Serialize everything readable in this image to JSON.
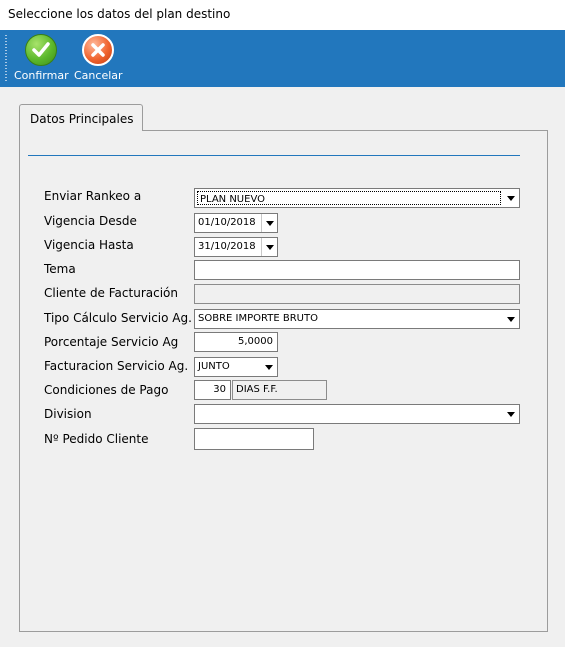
{
  "window": {
    "title": "Seleccione los datos del plan destino"
  },
  "toolbar": {
    "confirm_label": "Confirmar",
    "cancel_label": "Cancelar"
  },
  "tabs": {
    "main_label": "Datos Principales"
  },
  "form": {
    "enviar_rankeo": {
      "label": "Enviar Rankeo a",
      "value": "PLAN NUEVO"
    },
    "vigencia_desde": {
      "label": "Vigencia Desde",
      "value": "01/10/2018"
    },
    "vigencia_hasta": {
      "label": "Vigencia Hasta",
      "value": "31/10/2018"
    },
    "tema": {
      "label": "Tema",
      "value": ""
    },
    "cliente_facturacion": {
      "label": "Cliente de Facturación",
      "value": ""
    },
    "tipo_calculo": {
      "label": "Tipo Cálculo Servicio Ag.",
      "value": "SOBRE IMPORTE BRUTO"
    },
    "porcentaje": {
      "label": "Porcentaje Servicio Ag",
      "value": "5,0000"
    },
    "facturacion_servicio": {
      "label": "Facturacion Servicio Ag.",
      "value": "JUNTO"
    },
    "condiciones_pago": {
      "label": "Condiciones de Pago",
      "days": "30",
      "description": "DIAS F.F."
    },
    "division": {
      "label": "Division",
      "value": ""
    },
    "pedido_cliente": {
      "label": "Nº Pedido Cliente",
      "value": ""
    }
  },
  "colors": {
    "toolbar_bg": "#2277bd",
    "confirm_icon": "#5cb82c",
    "cancel_icon": "#f0642f"
  }
}
